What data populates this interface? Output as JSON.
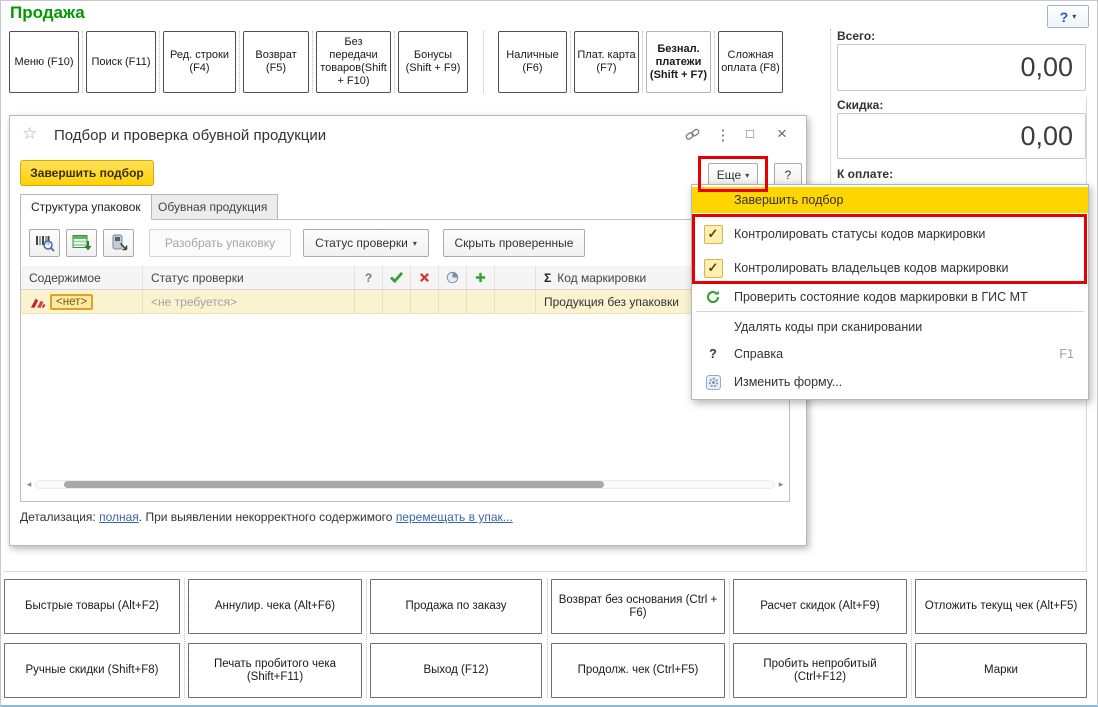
{
  "page": {
    "title": "Продажа"
  },
  "icons": {
    "star": "☆",
    "kebab": "⋮",
    "close": "×",
    "restore": "□",
    "question": "?",
    "dropdown_arrow": "▾",
    "scroll_left": "◂",
    "scroll_right": "▸",
    "sigma": "Σ",
    "check": "✓"
  },
  "colors": {
    "title_green": "#009900",
    "accent_yellow": "#ffd600",
    "annotation_red": "#e60000",
    "row_yellow": "#fbf2cf",
    "link_blue": "#3a66b0",
    "disabled_gray": "#a6a6a6"
  },
  "top_toolbar": {
    "buttons": [
      "Меню (F10)",
      "Поиск (F11)",
      "Ред. строки (F4)",
      "Возврат (F5)",
      "Без передачи товаров(Shift + F10)",
      "Бонусы (Shift + F9)",
      "Наличные (F6)",
      "Плат. карта (F7)",
      "Безнал. платежи (Shift + F7)",
      "Сложная оплата (F8)"
    ]
  },
  "totals": {
    "total_label": "Всего:",
    "total_value": "0,00",
    "discount_label": "Скидка:",
    "discount_value": "0,00",
    "to_pay_label": "К оплате:"
  },
  "dialog": {
    "title": "Подбор и проверка обувной продукции",
    "finish_button": "Завершить подбор",
    "more_button": "Еще",
    "help_button": "?",
    "tabs": [
      "Структура упаковок",
      "Обувная продукция"
    ],
    "toolbar": {
      "disassemble": "Разобрать упаковку",
      "status_filter": "Статус проверки",
      "hide_checked": "Скрыть проверенные"
    },
    "table": {
      "header_content": "Содержимое",
      "header_status": "Статус проверки",
      "header_question": "?",
      "header_marking": "Код маркировки",
      "row": {
        "content_value": "<нет>",
        "status_value": "<не требуется>",
        "marking_value": "Продукция без упаковки"
      }
    },
    "footer": {
      "label": "Детализация:",
      "link_detail": "полная",
      "middle": ". При выявлении некорректного содержимого",
      "link_move": "перемещать в упак..."
    }
  },
  "menu": {
    "items": [
      {
        "label": "Завершить подбор"
      },
      {
        "label": "Контролировать статусы кодов маркировки",
        "checked": true
      },
      {
        "label": "Контролировать владельцев кодов маркировки",
        "checked": true
      },
      {
        "label": "Проверить состояние кодов маркировки в ГИС МТ"
      },
      {
        "label": "Удалять коды при сканировании"
      },
      {
        "label": "Справка",
        "shortcut": "F1"
      },
      {
        "label": "Изменить форму..."
      }
    ]
  },
  "bottom": {
    "row1": [
      "Быстрые товары (Alt+F2)",
      "Аннулир. чека (Alt+F6)",
      "Продажа по заказу",
      "Возврат без основания (Ctrl + F6)",
      "Расчет скидок (Alt+F9)",
      "Отложить текущ чек (Alt+F5)"
    ],
    "row2": [
      "Ручные скидки (Shift+F8)",
      "Печать пробитого чека (Shift+F11)",
      "Выход (F12)",
      "Продолж. чек (Ctrl+F5)",
      "Пробить непробитый (Ctrl+F12)",
      "Марки"
    ]
  }
}
